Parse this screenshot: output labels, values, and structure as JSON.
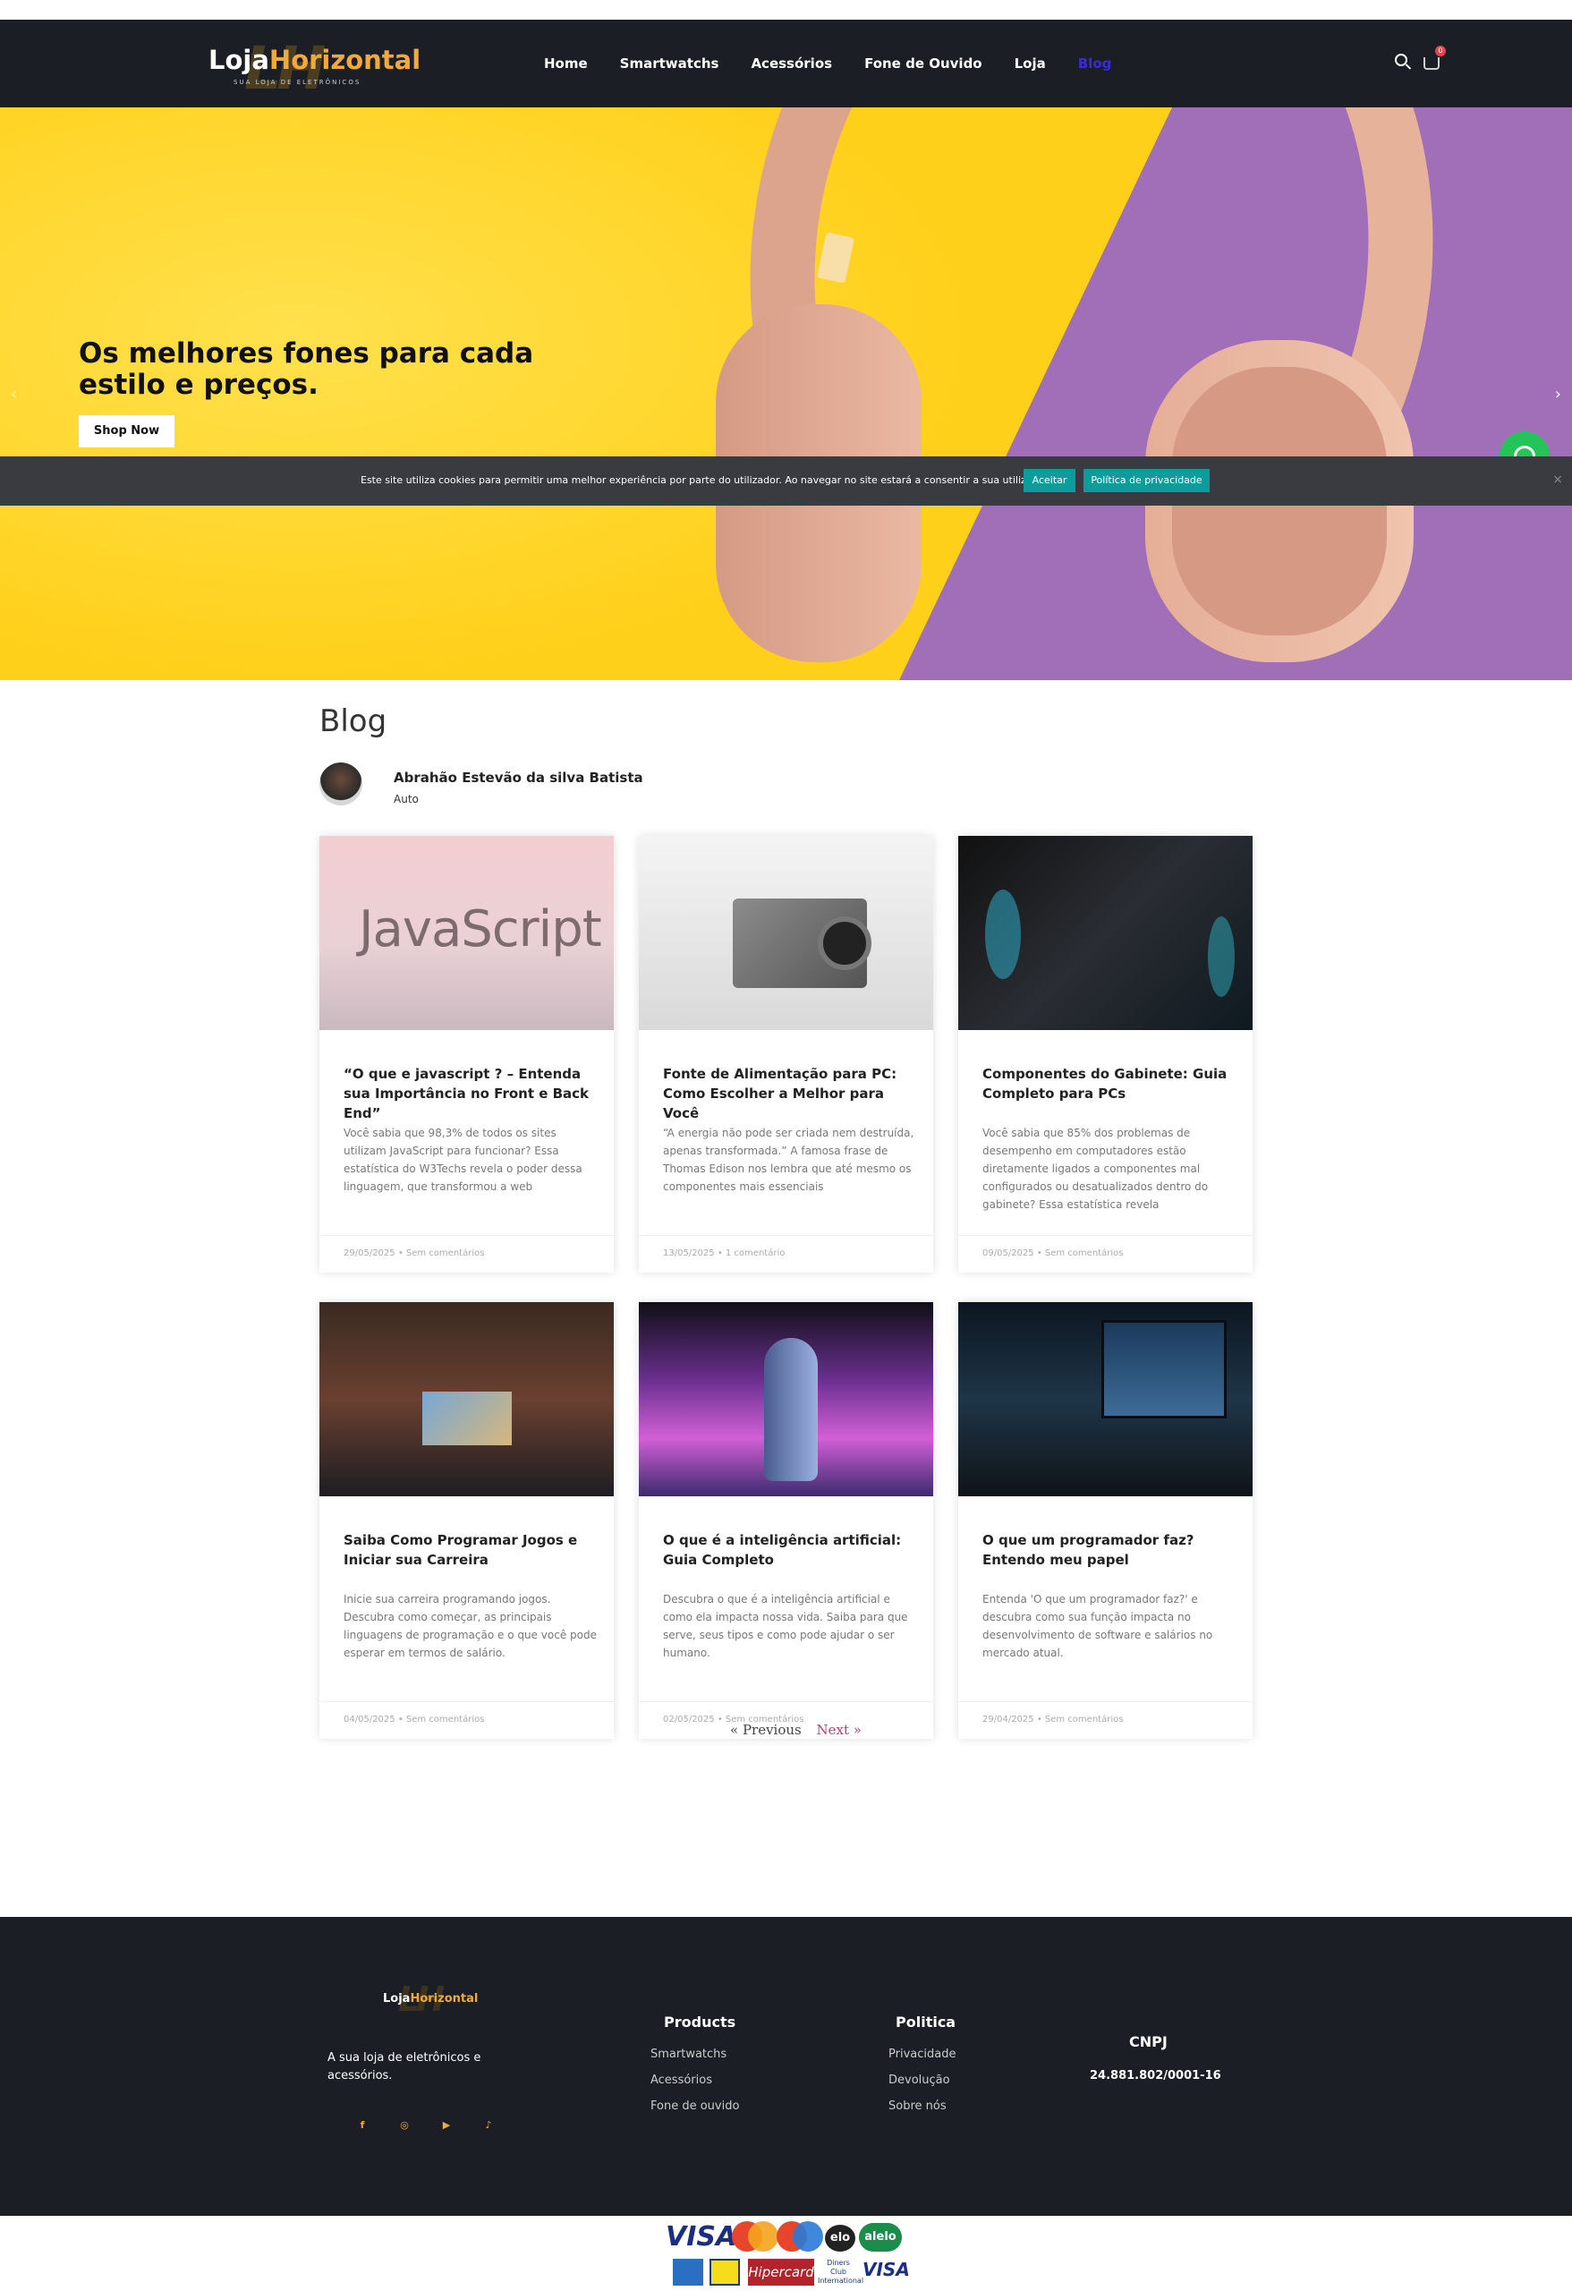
{
  "header": {
    "logo_main": "Loja",
    "logo_highlight": "Horizontal",
    "logo_sub": "SUA LOJA DE ELETRÔNICOS",
    "logo_bg": "LH",
    "nav": [
      "Home",
      "Smartwatchs",
      "Acessórios",
      "Fone de Ouvido",
      "Loja",
      "Blog"
    ],
    "active_nav": "Blog",
    "cart_count": "0",
    "icons": [
      "search-icon",
      "cart-icon"
    ]
  },
  "hero": {
    "title": "Os melhores fones para cada estilo e preços.",
    "button": "Shop Now",
    "prev_arrow": "‹",
    "next_arrow": "›"
  },
  "cookie": {
    "text": "Este site utiliza cookies para permitir uma melhor experiência por parte do utilizador. Ao navegar no site estará a consentir a sua utilização.",
    "accept": "Aceitar",
    "policy": "Política de privacidade",
    "close": "×"
  },
  "blog": {
    "title": "Blog",
    "author_name": "Abrahão Estevão da silva Batista",
    "author_role": "Auto",
    "posts": [
      {
        "title": "“O que e javascript ? – Entenda sua Importância no Front e Back End”",
        "excerpt": "Você sabia que 98,3% de todos os sites utilizam JavaScript para funcionar? Essa estatística do W3Techs revela o poder dessa linguagem, que transformou a web",
        "meta": "29/05/2025 • Sem comentários",
        "image_text": "JavaScript"
      },
      {
        "title": "Fonte de Alimentação para PC: Como Escolher a Melhor para Você",
        "excerpt": "“A energia não pode ser criada nem destruída, apenas transformada.” A famosa frase de Thomas Edison nos lembra que até mesmo os componentes mais essenciais",
        "meta": "13/05/2025 • 1 comentário"
      },
      {
        "title": "Componentes do Gabinete: Guia Completo para PCs",
        "excerpt": "Você sabia que 85% dos problemas de desempenho em computadores estão diretamente ligados a componentes mal configurados ou desatualizados dentro do gabinete? Essa estatística revela",
        "meta": "09/05/2025 • Sem comentários"
      },
      {
        "title": "Saiba Como Programar Jogos e Iniciar sua Carreira",
        "excerpt": "Inicie sua carreira programando jogos. Descubra como começar, as principais linguagens de programação e o que você pode esperar em termos de salário.",
        "meta": "04/05/2025 • Sem comentários"
      },
      {
        "title": "O que é a inteligência artificial: Guia Completo",
        "excerpt": "Descubra o que é a inteligência artificial e como ela impacta nossa vida. Saiba para que serve, seus tipos e como pode ajudar o ser humano.",
        "meta": "02/05/2025 • Sem comentários"
      },
      {
        "title": "O que um programador faz? Entendo meu papel",
        "excerpt": "Entenda 'O que um programador faz?' e descubra como sua função impacta no desenvolvimento de software e salários no mercado atual.",
        "meta": "29/04/2025 • Sem comentários"
      }
    ],
    "prev": "« Previous",
    "next": "Next »"
  },
  "footer": {
    "logo_main": "Loja",
    "logo_highlight": "Horizontal",
    "logo_bg": "LH",
    "description": "A sua loja de eletrônicos e acessórios.",
    "social": [
      "f",
      "◎",
      "▶",
      "♪"
    ],
    "products_title": "Products",
    "products": [
      "Smartwatchs",
      "Acessórios",
      "Fone de ouvido"
    ],
    "policy_title": "Politica",
    "policy": [
      "Privacidade",
      "Devolução",
      "Sobre nós"
    ],
    "cnpj_title": "CNPJ",
    "cnpj_value": "24.881.802/0001-16"
  },
  "payments": {
    "visa": "VISA",
    "elo": "elo",
    "alelo": "alelo",
    "hipercard": "Hipercard",
    "diners": "Diners Club International",
    "visa_electron": "VISA"
  }
}
